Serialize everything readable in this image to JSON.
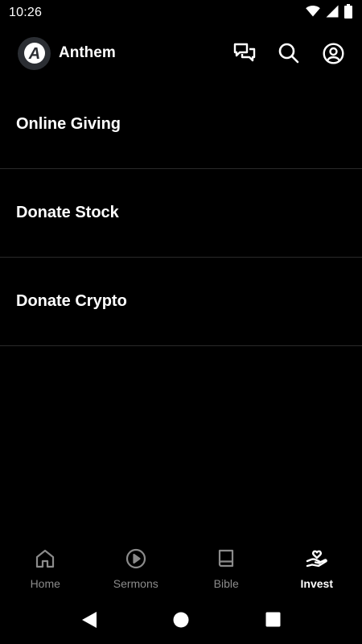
{
  "status_bar": {
    "time": "10:26",
    "icons": [
      "wifi-icon",
      "signal-icon",
      "battery-icon"
    ]
  },
  "app_bar": {
    "logo_letter": "A",
    "title": "Anthem",
    "actions": [
      "chat-icon",
      "search-icon",
      "account-icon"
    ]
  },
  "menu": {
    "items": [
      {
        "label": "Online Giving"
      },
      {
        "label": "Donate Stock"
      },
      {
        "label": "Donate Crypto"
      }
    ]
  },
  "bottom_nav": {
    "items": [
      {
        "label": "Home",
        "icon": "home-icon",
        "active": false
      },
      {
        "label": "Sermons",
        "icon": "play-circle-icon",
        "active": false
      },
      {
        "label": "Bible",
        "icon": "book-icon",
        "active": false
      },
      {
        "label": "Invest",
        "icon": "hand-heart-icon",
        "active": true
      }
    ]
  },
  "colors": {
    "background": "#000000",
    "text": "#ffffff",
    "inactive": "#8b8b8b",
    "divider": "#2a2a2a",
    "logo_bg": "#2b2e33"
  }
}
